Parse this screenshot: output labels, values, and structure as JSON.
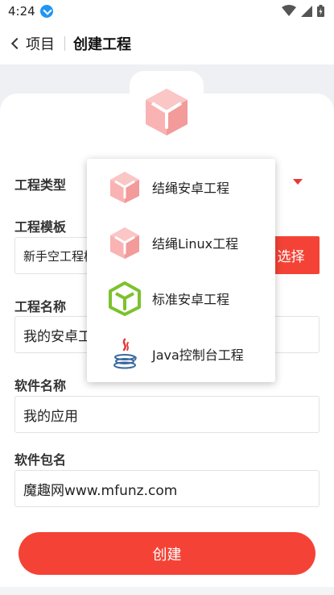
{
  "status_bar": {
    "time": "4:24"
  },
  "app_bar": {
    "back_label": "项目",
    "title": "创建工程"
  },
  "form": {
    "project_type": {
      "label": "工程类型"
    },
    "project_template": {
      "label": "工程模板",
      "value": "新手空工程模",
      "select_button": "选择"
    },
    "project_name": {
      "label": "工程名称",
      "value": "我的安卓工"
    },
    "app_name": {
      "label": "软件名称",
      "value": "我的应用"
    },
    "package_name": {
      "label": "软件包名",
      "value": "魔趣网www.mfunz.com"
    },
    "create_button": "创建"
  },
  "popup_menu": {
    "items": [
      {
        "label": "结绳安卓工程",
        "icon": "pink-cube-icon"
      },
      {
        "label": "结绳Linux工程",
        "icon": "pink-cube-icon"
      },
      {
        "label": "标准安卓工程",
        "icon": "green-hexagon-cube-icon"
      },
      {
        "label": "Java控制台工程",
        "icon": "java-coffee-icon"
      }
    ]
  },
  "colors": {
    "accent": "#f44336",
    "pink": "#f7a3a3",
    "green": "#7cc22c"
  }
}
